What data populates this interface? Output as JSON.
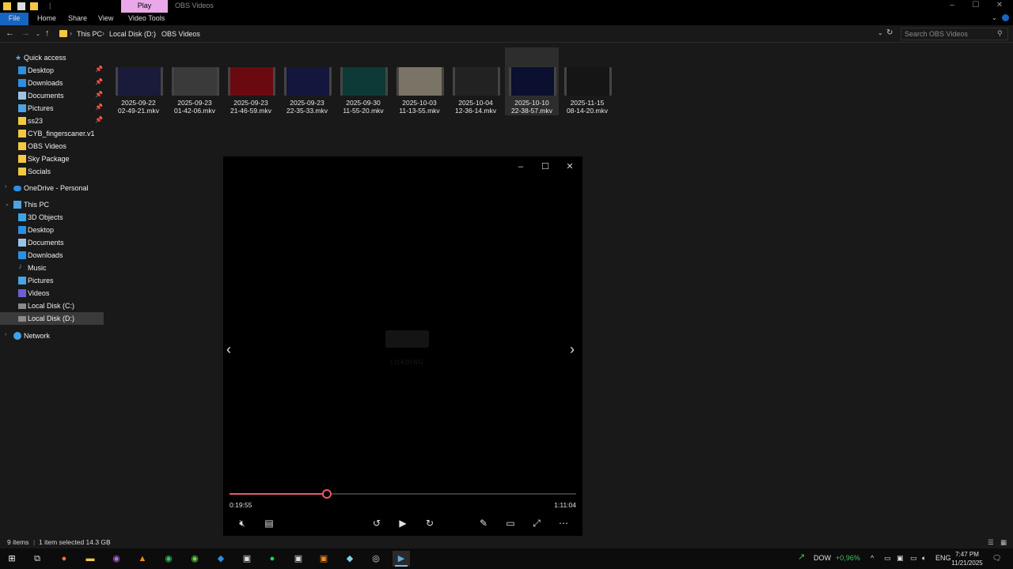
{
  "window": {
    "title": "OBS Videos",
    "play_tab": "Play",
    "controls": {
      "minimize": "–",
      "maximize": "☐",
      "close": "✕"
    }
  },
  "ribbon": {
    "tabs": [
      "File",
      "Home",
      "Share",
      "View",
      "Video Tools"
    ]
  },
  "address": {
    "crumbs": [
      "This PC",
      "Local Disk (D:)",
      "OBS Videos"
    ],
    "search_placeholder": "Search OBS Videos"
  },
  "sidebar": {
    "quick_access": "Quick access",
    "pinned": [
      "Desktop",
      "Downloads",
      "Documents",
      "Pictures",
      "ss23"
    ],
    "recent": [
      "CYB_fingerscaner.v1",
      "OBS Videos",
      "Sky Package",
      "Socials"
    ],
    "onedrive": "OneDrive - Personal",
    "this_pc": "This PC",
    "pc_items": [
      "3D Objects",
      "Desktop",
      "Documents",
      "Downloads",
      "Music",
      "Pictures",
      "Videos",
      "Local Disk (C:)",
      "Local Disk (D:)"
    ],
    "network": "Network",
    "selected": "Local Disk (D:)"
  },
  "files": [
    {
      "line1": "2025-09-22",
      "line2": "02-49-21.mkv",
      "thumb": "#1a1a3a"
    },
    {
      "line1": "2025-09-23",
      "line2": "01-42-06.mkv",
      "thumb": "#3a3a3a"
    },
    {
      "line1": "2025-09-23",
      "line2": "21-46-59.mkv",
      "thumb": "#6a0a10"
    },
    {
      "line1": "2025-09-23",
      "line2": "22-35-33.mkv",
      "thumb": "#14163e"
    },
    {
      "line1": "2025-09-30",
      "line2": "11-55-20.mkv",
      "thumb": "#0d3a36"
    },
    {
      "line1": "2025-10-03",
      "line2": "11-13-55.mkv",
      "thumb": "#7a7466"
    },
    {
      "line1": "2025-10-04",
      "line2": "12-36-14.mkv",
      "thumb": "#222"
    },
    {
      "line1": "2025-10-10",
      "line2": "22-38-57.mkv",
      "thumb": "#0b1030"
    },
    {
      "line1": "2025-11-15",
      "line2": "08-14-20.mkv",
      "thumb": "#151515"
    }
  ],
  "player": {
    "current_time": "0:19:55",
    "total_time": "1:11:04",
    "progress": 0.28,
    "loading_text": "LOADING",
    "accent": "#e6596c"
  },
  "status": {
    "items": "9 items",
    "selection": "1 item selected  14.3 GB"
  },
  "taskbar": {
    "stock_name": "DOW",
    "stock_change": "+0,96%",
    "language": "ENG",
    "time": "7:47 PM",
    "date": "11/21/2025"
  }
}
